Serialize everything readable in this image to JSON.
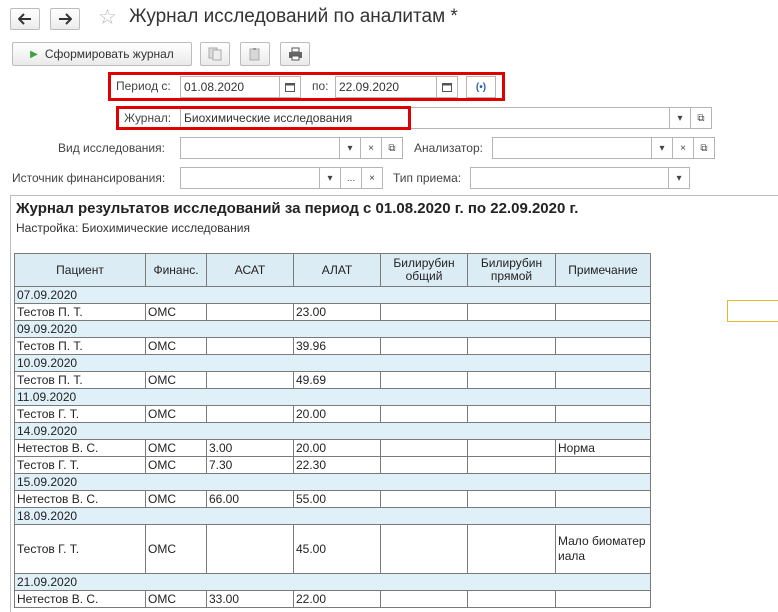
{
  "window": {
    "title": "Журнал исследований по аналитам *"
  },
  "toolbar": {
    "generate_label": "Сформировать журнал"
  },
  "filters": {
    "period_from_label": "Период с:",
    "period_from_value": "01.08.2020",
    "period_to_label": "по:",
    "period_to_value": "22.09.2020",
    "journal_label": "Журнал:",
    "journal_value": "Биохимические исследования",
    "research_type_label": "Вид исследования:",
    "research_type_value": "",
    "analyzer_label": "Анализатор:",
    "analyzer_value": "",
    "funding_label": "Источник финансирования:",
    "funding_value": "",
    "reception_label": "Тип приема:",
    "reception_value": ""
  },
  "report": {
    "title": "Журнал результатов исследований за период с 01.08.2020 г. по 22.09.2020 г.",
    "settings": "Настройка: Биохимические исследования",
    "columns": [
      "Пациент",
      "Финанс.",
      "АСАТ",
      "АЛАТ",
      "Билирубин общий",
      "Билирубин прямой",
      "Примечание"
    ],
    "rows": [
      {
        "type": "date",
        "date": "07.09.2020"
      },
      {
        "type": "data",
        "cells": [
          "Тестов П. Т.",
          "ОМС",
          "",
          "23.00",
          "",
          "",
          ""
        ]
      },
      {
        "type": "date",
        "date": "09.09.2020"
      },
      {
        "type": "data",
        "cells": [
          "Тестов П. Т.",
          "ОМС",
          "",
          "39.96",
          "",
          "",
          ""
        ]
      },
      {
        "type": "date",
        "date": "10.09.2020"
      },
      {
        "type": "data",
        "cells": [
          "Тестов П. Т.",
          "ОМС",
          "",
          "49.69",
          "",
          "",
          ""
        ]
      },
      {
        "type": "date",
        "date": "11.09.2020"
      },
      {
        "type": "data",
        "cells": [
          "Тестов Г. Т.",
          "ОМС",
          "",
          "20.00",
          "",
          "",
          ""
        ]
      },
      {
        "type": "date",
        "date": "14.09.2020"
      },
      {
        "type": "data",
        "cells": [
          "Нетестов В. С.",
          "ОМС",
          "3.00",
          "20.00",
          "",
          "",
          "Норма"
        ]
      },
      {
        "type": "data",
        "cells": [
          "Тестов Г. Т.",
          "ОМС",
          "7.30",
          "22.30",
          "",
          "",
          ""
        ]
      },
      {
        "type": "date",
        "date": "15.09.2020"
      },
      {
        "type": "data",
        "cells": [
          "Нетестов В. С.",
          "ОМС",
          "66.00",
          "55.00",
          "",
          "",
          ""
        ]
      },
      {
        "type": "date",
        "date": "18.09.2020"
      },
      {
        "type": "data",
        "tall": true,
        "cells": [
          "Тестов Г. Т.",
          "ОМС",
          "",
          "45.00",
          "",
          "",
          "Мало биоматериала"
        ]
      },
      {
        "type": "date",
        "date": "21.09.2020"
      },
      {
        "type": "data",
        "cells": [
          "Нетестов В. С.",
          "ОМС",
          "33.00",
          "22.00",
          "",
          "",
          ""
        ]
      }
    ]
  }
}
